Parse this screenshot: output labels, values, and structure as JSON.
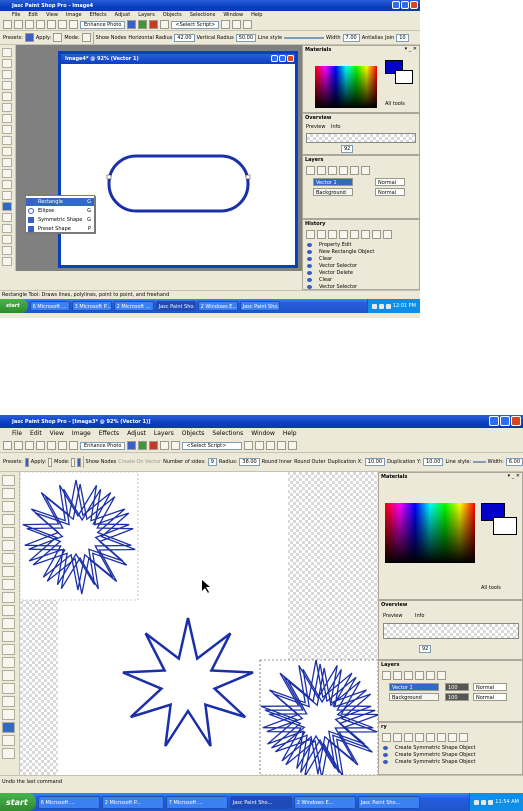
{
  "shot1": {
    "title": "Jasc Paint Shop Pro - Image4",
    "menu": [
      "File",
      "Edit",
      "View",
      "Image",
      "Effects",
      "Adjust",
      "Layers",
      "Objects",
      "Selections",
      "Window",
      "Help"
    ],
    "toolbar": {
      "enhance_photo": "Enhance Photo",
      "select_script": "<Select Script>"
    },
    "tool_options": {
      "labels": [
        "Presets:",
        "Apply:",
        "Mode:",
        "Show Nodes",
        "Horizontal Radius",
        "Vertical Radius",
        "Line style",
        "Width",
        "Join",
        "Miter limit"
      ],
      "values": {
        "horizontal_radius": "42.00",
        "vertical_radius": "50.00",
        "width": "7.00",
        "join": "10"
      },
      "antialias": "Antialias",
      "create_on_vector": "Create as vector"
    },
    "image_window_title": "Image4* @ 92% (Vector 1)",
    "shape_flyout": [
      {
        "label": "Rectangle",
        "key": "G",
        "selected": true
      },
      {
        "label": "Ellipse",
        "key": "G",
        "selected": false
      },
      {
        "label": "Symmetric Shape",
        "key": "G",
        "selected": false
      },
      {
        "label": "Preset Shape",
        "key": "P",
        "selected": false
      }
    ],
    "palettes": {
      "materials": "Materials",
      "all_tools": "All tools",
      "overview": "Overview",
      "overview_tabs": [
        "Preview",
        "Info"
      ],
      "zoom": "92",
      "layers": "Layers",
      "layer_rows": [
        {
          "name": "Vector 1",
          "mode": "Normal",
          "selected": true
        },
        {
          "name": "Background",
          "mode": "Normal",
          "selected": false
        }
      ],
      "history": "History",
      "history_rows": [
        "Property Edit",
        "New Rectangle Object",
        "Clear",
        "Vector Selector",
        "Vector Delete",
        "Clear",
        "Vector Selector"
      ]
    },
    "status": "Rectangle Tool: Draws lines, polylines, point to point, and freehand",
    "taskbar": {
      "start": "start",
      "tasks": [
        "6 Microsoft ...",
        "3 Microsoft P...",
        "2 Microsoft ...",
        "Jasc Paint Sho...",
        "2 Windows E...",
        "Jasc Paint Sho..."
      ],
      "clock": "12:01 PM"
    }
  },
  "shot2": {
    "title": "Jasc Paint Shop Pro - [Image3* @ 92% (Vector 1)]",
    "menu": [
      "File",
      "Edit",
      "View",
      "Image",
      "Effects",
      "Adjust",
      "Layers",
      "Objects",
      "Selections",
      "Window",
      "Help"
    ],
    "toolbar": {
      "enhance_photo": "Enhance Photo",
      "select_script": "<Select Script>"
    },
    "tool_options": {
      "labels": [
        "Presets:",
        "Apply:",
        "Mode:",
        "Show Nodes",
        "Number of sides:",
        "Radius:",
        "Round Inner",
        "Round Outer",
        "Duplication X:",
        "Duplication Y:",
        "Line style:",
        "Width:"
      ],
      "values": {
        "sides": "9",
        "radius": "38.00",
        "dup_x": "10.00",
        "dup_y": "10.00",
        "width": "6.00"
      },
      "create_on_vector": "Create On Vector"
    },
    "palettes": {
      "materials": "Materials",
      "all_tools": "All tools",
      "overview": "Overview",
      "overview_tabs": [
        "Preview",
        "Info"
      ],
      "zoom": "92",
      "layers": "Layers",
      "layer_rows": [
        {
          "name": "Vector 1",
          "opacity": "100",
          "mode": "Normal",
          "selected": true
        },
        {
          "name": "Background",
          "opacity": "100",
          "mode": "Normal",
          "selected": false
        }
      ],
      "history": "ry",
      "history_rows": [
        "Create Symmetric Shape Object",
        "Create Symmetric Shape Object",
        "Create Symmetric Shape Object"
      ]
    },
    "status": "Undo the last command",
    "taskbar": {
      "start": "start",
      "tasks": [
        "6 Microsoft ...",
        "2 Microsoft P...",
        "7 Microsoft ...",
        "Jasc Paint Sho...",
        "2 Windows E...",
        "Jasc Paint Sho..."
      ],
      "clock": "11:54 AM"
    }
  },
  "colors": {
    "title_blue": "#0a3fbf",
    "shape_stroke": "#1a2fa8",
    "foreground_swatch": "#0000c8",
    "start_green": "#3a9a3a"
  }
}
